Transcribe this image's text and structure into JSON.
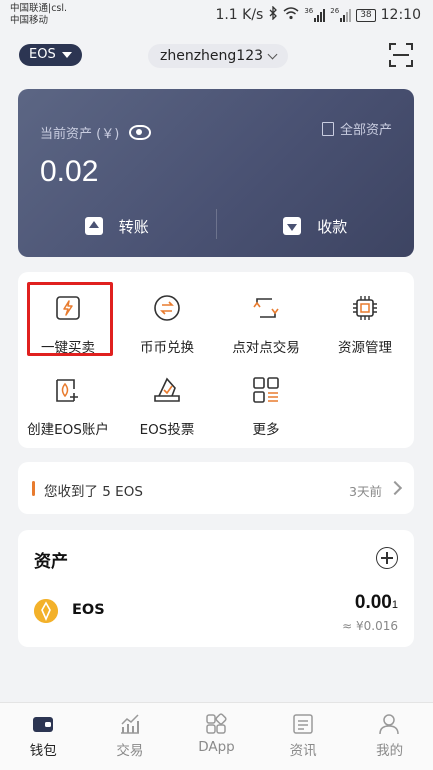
{
  "status_bar": {
    "carrier_1": "中国联通|csl.",
    "carrier_2": "中国移动",
    "speed": "1.1 K/s",
    "net_1": "36",
    "net_2": "26",
    "battery": "38",
    "time": "12:10"
  },
  "header": {
    "coin": "EOS",
    "account": "zhenzheng123"
  },
  "wallet_card": {
    "label": "当前资产 (￥)",
    "all_assets": "全部资产",
    "amount": "0.02",
    "transfer": "转账",
    "receive": "收款"
  },
  "features": [
    {
      "label": "一键买卖",
      "icon": "flash-trade-icon"
    },
    {
      "label": "币币兑换",
      "icon": "exchange-icon"
    },
    {
      "label": "点对点交易",
      "icon": "p2p-icon"
    },
    {
      "label": "资源管理",
      "icon": "chip-icon"
    },
    {
      "label": "创建EOS账户",
      "icon": "create-account-icon"
    },
    {
      "label": "EOS投票",
      "icon": "vote-icon"
    },
    {
      "label": "更多",
      "icon": "more-grid-icon"
    }
  ],
  "notice": {
    "text": "您收到了 5 EOS",
    "time": "3天前"
  },
  "assets": {
    "title": "资产",
    "items": [
      {
        "name": "EOS",
        "balance": "0.00",
        "balance_suffix": "1",
        "fiat": "≈ ¥0.016"
      }
    ]
  },
  "tabs": [
    {
      "label": "钱包",
      "icon": "wallet-icon",
      "active": true
    },
    {
      "label": "交易",
      "icon": "chart-icon",
      "active": false
    },
    {
      "label": "DApp",
      "icon": "dapp-icon",
      "active": false
    },
    {
      "label": "资讯",
      "icon": "news-icon",
      "active": false
    },
    {
      "label": "我的",
      "icon": "profile-icon",
      "active": false
    }
  ],
  "colors": {
    "hero_card": "#4a5273",
    "accent_orange": "#e87b2e",
    "highlight_red": "#e0201f",
    "coin_gold": "#f3b12a"
  }
}
